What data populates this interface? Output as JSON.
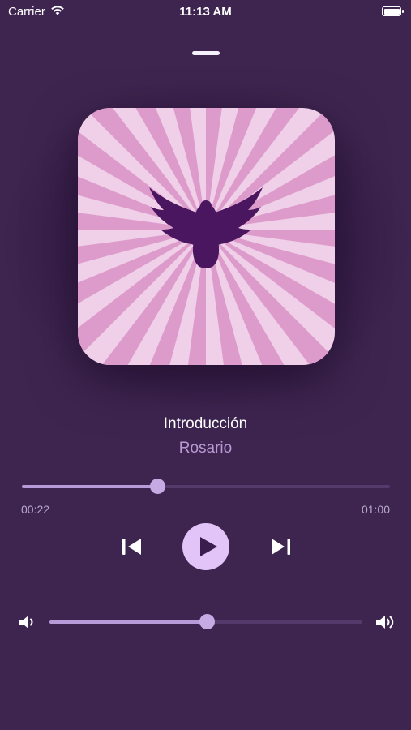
{
  "status_bar": {
    "carrier": "Carrier",
    "time": "11:13 AM"
  },
  "track": {
    "title": "Introducción",
    "artist": "Rosario"
  },
  "progress": {
    "elapsed": "00:22",
    "total": "01:00",
    "fraction": 0.37
  },
  "volume": {
    "fraction": 0.505
  },
  "icons": {
    "previous": "backward-end-icon",
    "play": "play-icon",
    "next": "forward-end-icon",
    "volume_low": "speaker-low-icon",
    "volume_high": "speaker-high-icon",
    "artwork": "dove-icon"
  },
  "colors": {
    "background": "#3e2550",
    "accent": "#b79ad8",
    "play_button": "#e2c4f8",
    "artwork_light": "#f0cfe8",
    "artwork_dark": "#dd9bcc",
    "dove": "#4a1660"
  }
}
